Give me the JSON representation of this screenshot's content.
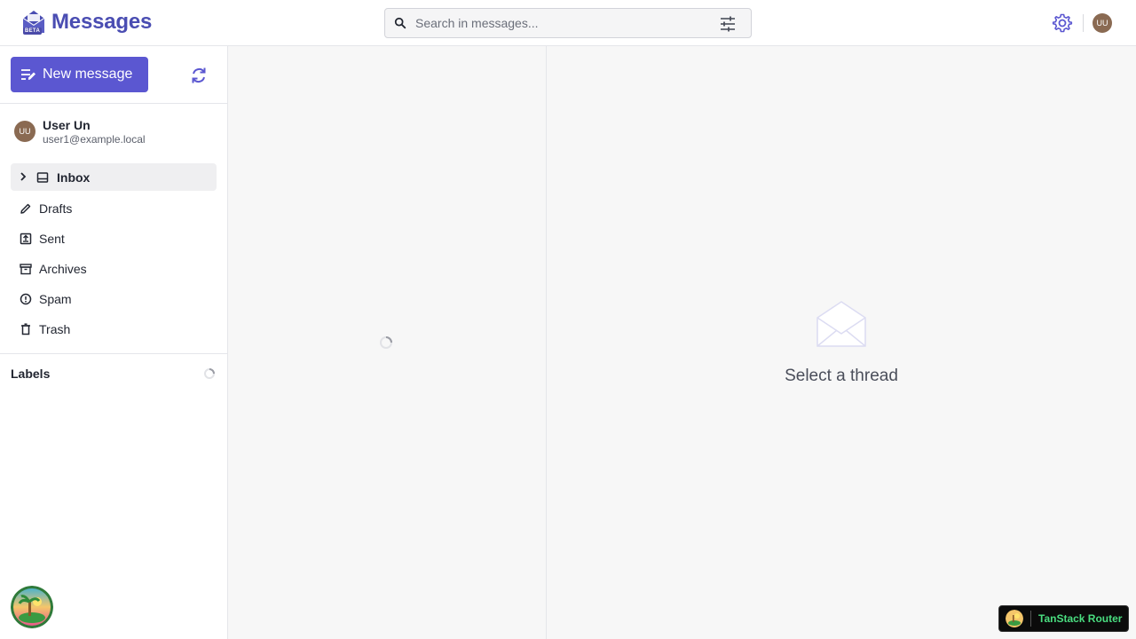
{
  "app": {
    "title": "Messages",
    "beta_badge": "BETA",
    "brand_color": "#4a4db2",
    "accent_color": "#5b57d1"
  },
  "search": {
    "placeholder": "Search in messages..."
  },
  "user": {
    "initials": "UU",
    "name": "User Un",
    "email": "user1@example.local"
  },
  "sidebar": {
    "new_message_label": "New message",
    "folders": [
      {
        "label": "Inbox",
        "icon": "inbox-icon",
        "active": true
      },
      {
        "label": "Drafts",
        "icon": "pencil-icon"
      },
      {
        "label": "Sent",
        "icon": "sent-icon"
      },
      {
        "label": "Archives",
        "icon": "archive-icon"
      },
      {
        "label": "Spam",
        "icon": "spam-icon"
      },
      {
        "label": "Trash",
        "icon": "trash-icon"
      }
    ],
    "labels_title": "Labels"
  },
  "thread_view": {
    "empty_text": "Select a thread"
  },
  "devtools": {
    "router_label": "TanStack Router"
  }
}
